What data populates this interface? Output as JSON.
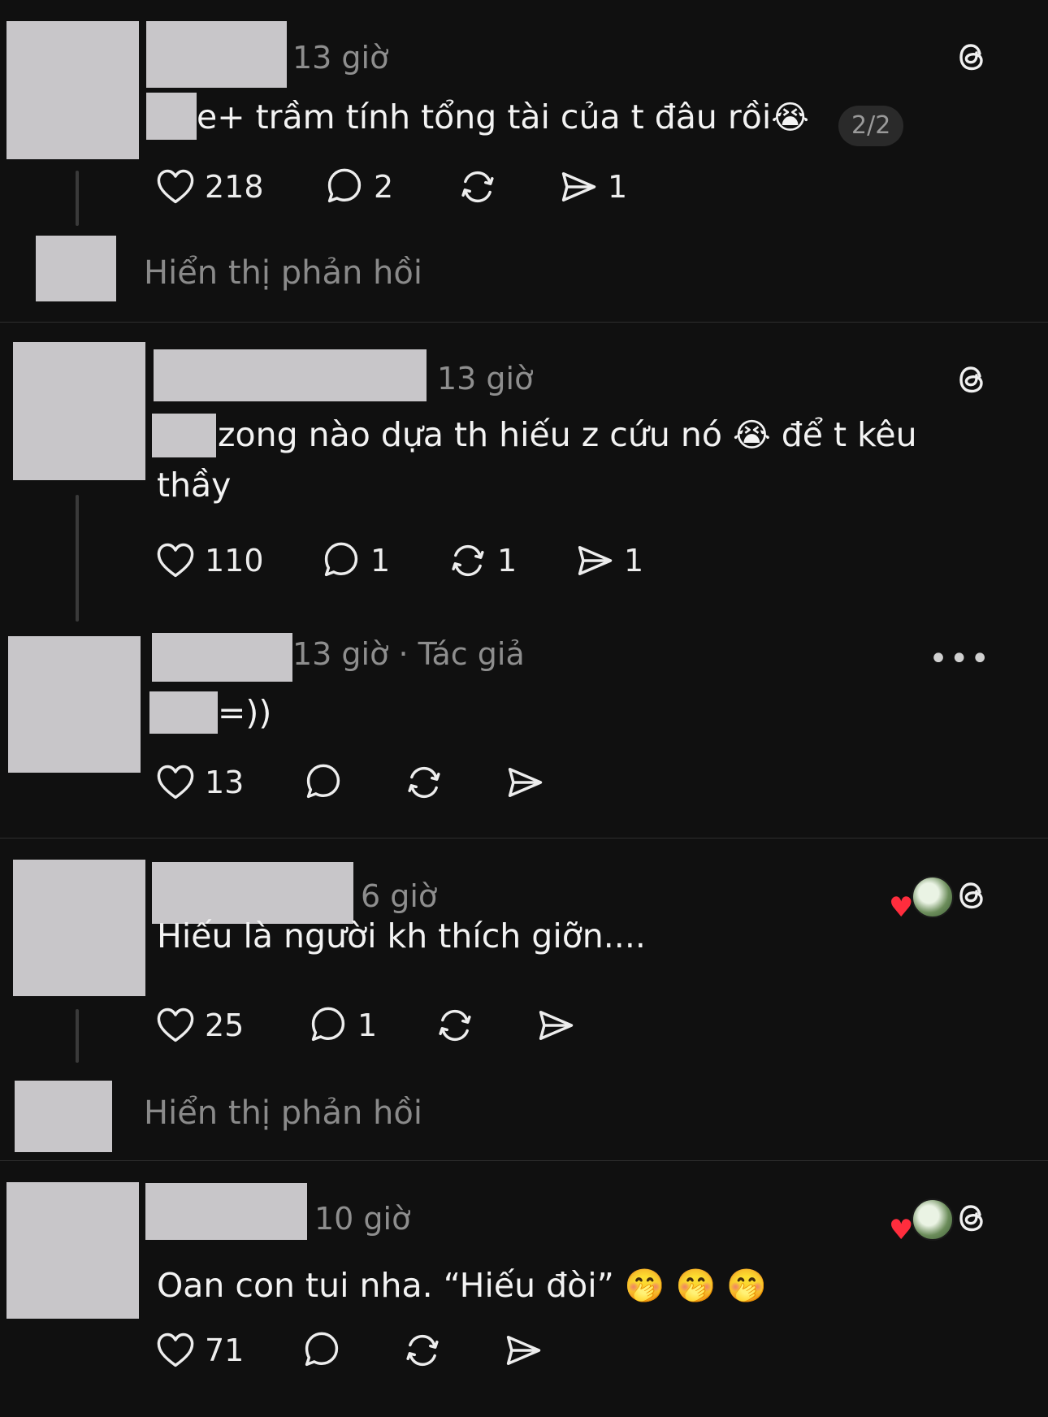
{
  "icons": {
    "like": "heart-outline-icon",
    "reply": "speech-bubble-icon",
    "repost": "repost-arrows-icon",
    "share": "paper-plane-icon",
    "threads": "threads-logo-icon",
    "more": "more-dots-icon"
  },
  "colors": {
    "background": "#101010",
    "text": "#f3f3f3",
    "secondary": "#8e8e8e",
    "heart_badge": "#ff2d3d"
  },
  "posts": [
    {
      "time": "13 giờ",
      "text": "e+ trầm tính tổng tài của t đâu rồi",
      "emoji": "😭",
      "page_indicator": "2/2",
      "likes": "218",
      "replies": "2",
      "reposts": "",
      "shares": "1",
      "show_replies": "Hiển thị phản hồi"
    },
    {
      "time": "13 giờ",
      "text_line1": "zong nào dựa th hiếu z cứu nó ",
      "emoji": "😭",
      "text_line1_tail": " để t kêu",
      "text_line2": "thầy",
      "likes": "110",
      "replies": "1",
      "reposts": "1",
      "shares": "1"
    },
    {
      "time": "13 giờ · Tác giả",
      "text": "=))",
      "likes": "13",
      "more": "•••"
    },
    {
      "time": "6 giờ",
      "text": "Hiếu là người kh thích giỡn....",
      "likes": "25",
      "replies": "1",
      "show_replies": "Hiển thị phản hồi",
      "liked_by_author": "♥"
    },
    {
      "time": "10 giờ",
      "text": "Oan con tui nha. “Hiếu đòi” ",
      "emojis": "🤭 🤭 🤭",
      "likes": "71",
      "liked_by_author": "♥"
    }
  ]
}
